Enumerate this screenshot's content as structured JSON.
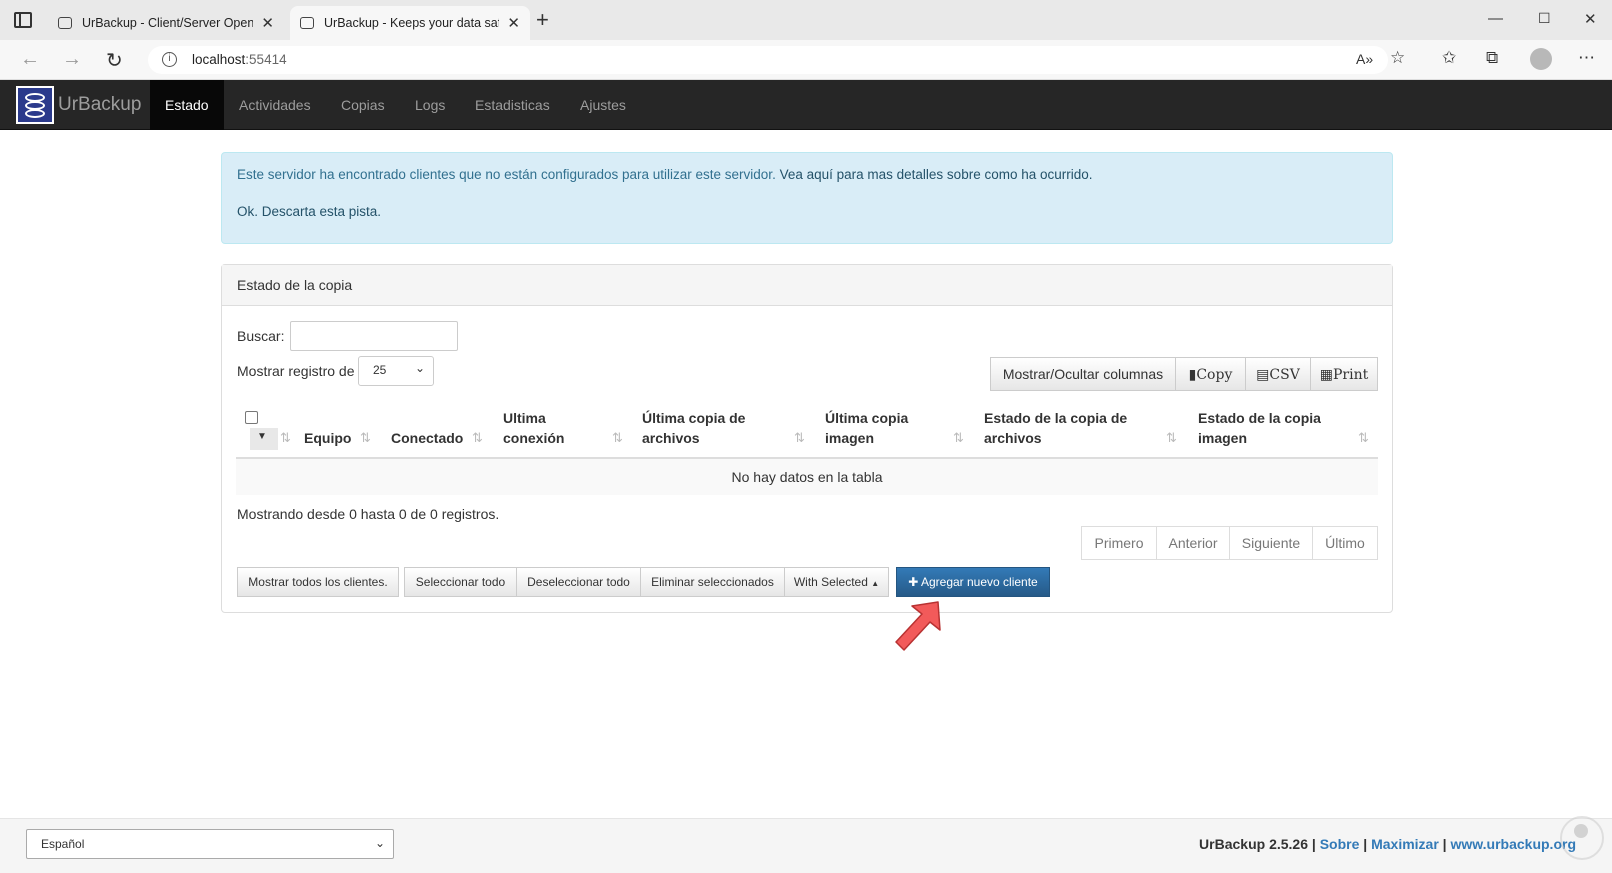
{
  "browser": {
    "tabs": [
      {
        "title": "UrBackup - Client/Server Open S",
        "active": false
      },
      {
        "title": "UrBackup - Keeps your data safe",
        "active": true
      }
    ],
    "url_host": "localhost",
    "url_port": ":55414",
    "icons": {
      "tab_actions": "tab-actions-icon",
      "back": "back-arrow-icon",
      "forward": "forward-arrow-icon",
      "refresh": "refresh-icon",
      "info": "info-icon",
      "read_aloud": "read-aloud-icon",
      "favorite_add": "favorite-add-icon",
      "favorites": "favorites-icon",
      "collections": "collections-icon",
      "profile": "profile-icon",
      "more": "more-icon"
    }
  },
  "navbar": {
    "brand": "UrBackup",
    "items": [
      {
        "label": "Estado",
        "active": true
      },
      {
        "label": "Actividades",
        "active": false
      },
      {
        "label": "Copias",
        "active": false
      },
      {
        "label": "Logs",
        "active": false
      },
      {
        "label": "Estadisticas",
        "active": false
      },
      {
        "label": "Ajustes",
        "active": false
      }
    ]
  },
  "alert": {
    "text_prefix": "Este servidor ha encontrado clientes que no están configurados para utilizar este servidor. ",
    "link_text": "Vea aquí para mas detalles sobre como ha ocurrido.",
    "dismiss_text": "Ok. Descarta esta pista."
  },
  "panel": {
    "title": "Estado de la copia",
    "search_label": "Buscar:",
    "search_value": "",
    "page_length_label": "Mostrar registro de",
    "page_length_value": "25",
    "toolbar": {
      "columns": "Mostrar/Ocultar columnas",
      "copy": "Copy",
      "csv": "CSV",
      "print": "Print"
    },
    "columns": [
      "Equipo",
      "Conectado",
      "Ultima conexión",
      "Última copia de archivos",
      "Última copia imagen",
      "Estado de la copia de archivos",
      "Estado de la copia imagen"
    ],
    "empty_text": "No hay datos en la tabla",
    "info_text": "Mostrando desde 0 hasta 0 de 0 registros.",
    "pager": [
      "Primero",
      "Anterior",
      "Siguiente",
      "Último"
    ],
    "actions": {
      "show_all": "Mostrar todos los clientes.",
      "select_all": "Seleccionar todo",
      "deselect_all": "Deseleccionar todo",
      "delete_selected": "Eliminar seleccionados",
      "with_selected": "With Selected",
      "add_client": "Agregar nuevo cliente"
    }
  },
  "footer": {
    "language": "Español",
    "version": "UrBackup 2.5.26",
    "about": "Sobre",
    "maximize": "Maximizar",
    "website": "www.urbackup.org"
  },
  "colors": {
    "navbar_bg": "#262626",
    "alert_bg": "#d9edf7",
    "alert_text": "#31708f",
    "primary": "#337ab7",
    "arrow": "#f25a5a"
  }
}
